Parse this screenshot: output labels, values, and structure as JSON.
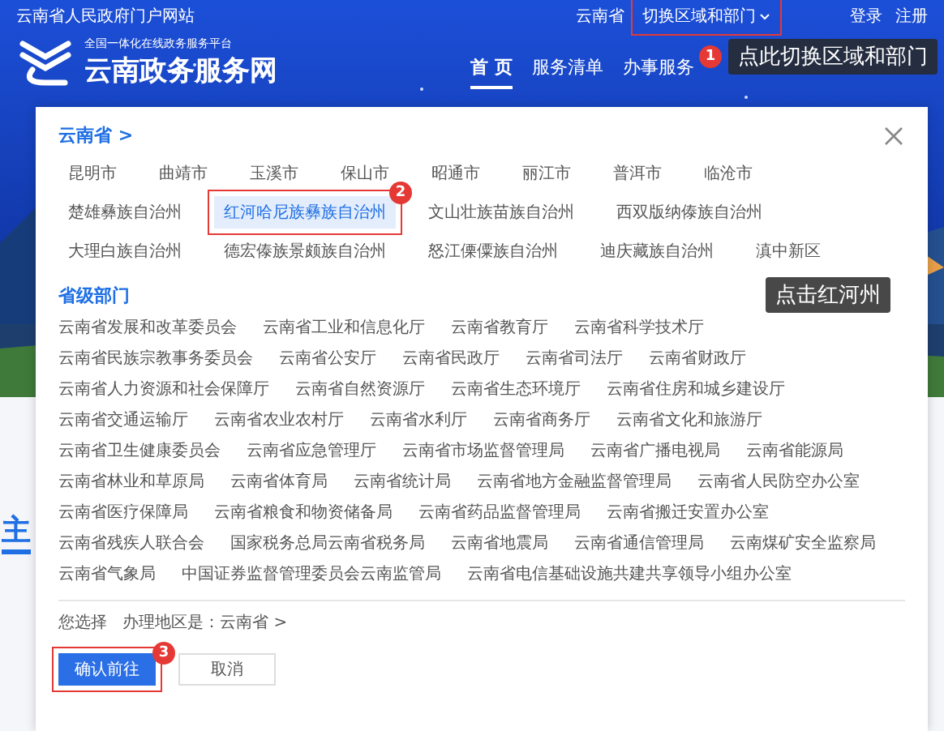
{
  "top_bar": {
    "site_link": "云南省人民政府门户网站",
    "region": "云南省",
    "switch_button": "切换区域和部门",
    "login": "登录",
    "register": "注册"
  },
  "brand": {
    "slogan": "全国一体化在线政务服务平台",
    "name": "云南政务服务网"
  },
  "nav": [
    {
      "label": "首 页",
      "selected": true
    },
    {
      "label": "服务清单",
      "selected": false
    },
    {
      "label": "办事服务",
      "selected": false
    }
  ],
  "page": {
    "section_heading": "主"
  },
  "dialog": {
    "breadcrumb": "云南省 >",
    "cities": [
      {
        "label": "昆明市",
        "selected": false
      },
      {
        "label": "曲靖市",
        "selected": false
      },
      {
        "label": "玉溪市",
        "selected": false
      },
      {
        "label": "保山市",
        "selected": false
      },
      {
        "label": "昭通市",
        "selected": false
      },
      {
        "label": "丽江市",
        "selected": false
      },
      {
        "label": "普洱市",
        "selected": false
      },
      {
        "label": "临沧市",
        "selected": false
      },
      {
        "label": "楚雄彝族自治州",
        "selected": false
      },
      {
        "label": "红河哈尼族彝族自治州",
        "selected": true
      },
      {
        "label": "文山壮族苗族自治州",
        "selected": false
      },
      {
        "label": "西双版纳傣族自治州",
        "selected": false
      },
      {
        "label": "大理白族自治州",
        "selected": false
      },
      {
        "label": "德宏傣族景颇族自治州",
        "selected": false
      },
      {
        "label": "怒江傈僳族自治州",
        "selected": false
      },
      {
        "label": "迪庆藏族自治州",
        "selected": false
      },
      {
        "label": "滇中新区",
        "selected": false
      }
    ],
    "department_heading": "省级部门",
    "departments": [
      "云南省发展和改革委员会",
      "云南省工业和信息化厅",
      "云南省教育厅",
      "云南省科学技术厅",
      "云南省民族宗教事务委员会",
      "云南省公安厅",
      "云南省民政厅",
      "云南省司法厅",
      "云南省财政厅",
      "云南省人力资源和社会保障厅",
      "云南省自然资源厅",
      "云南省生态环境厅",
      "云南省住房和城乡建设厅",
      "云南省交通运输厅",
      "云南省农业农村厅",
      "云南省水利厅",
      "云南省商务厅",
      "云南省文化和旅游厅",
      "云南省卫生健康委员会",
      "云南省应急管理厅",
      "云南省市场监督管理局",
      "云南省广播电视局",
      "云南省能源局",
      "云南省林业和草原局",
      "云南省体育局",
      "云南省统计局",
      "云南省地方金融监督管理局",
      "云南省人民防空办公室",
      "云南省医疗保障局",
      "云南省粮食和物资储备局",
      "云南省药品监督管理局",
      "云南省搬迁安置办公室",
      "云南省残疾人联合会",
      "国家税务总局云南省税务局",
      "云南省地震局",
      "云南省通信管理局",
      "云南煤矿安全监察局",
      "云南省气象局",
      "中国证券监督管理委员会云南监管局",
      "云南省电信基础设施共建共享领导小组办公室"
    ],
    "selection": "您选择   办理地区是：云南省 >",
    "confirm": "确认前往",
    "cancel": "取消"
  },
  "annotations": [
    {
      "number": "1",
      "text": "点此切换区域和部门"
    },
    {
      "number": "2",
      "text": "点击红河州"
    },
    {
      "number": "3"
    }
  ]
}
